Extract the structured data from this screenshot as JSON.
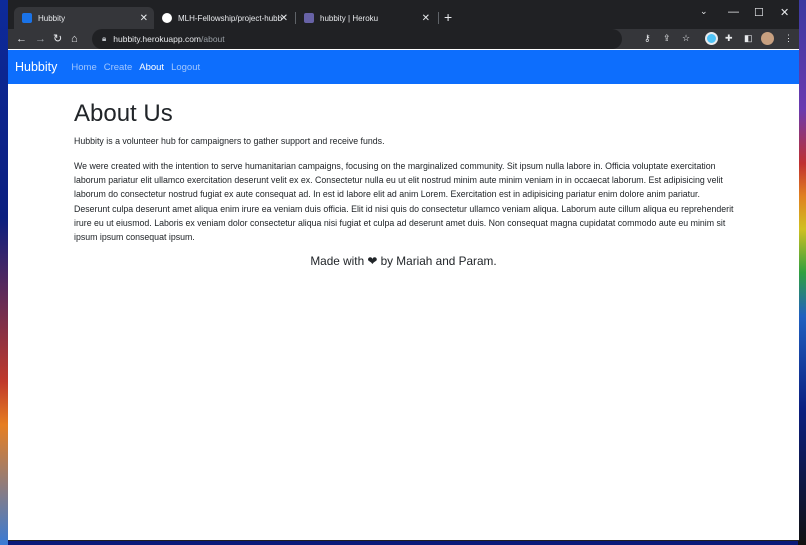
{
  "browser": {
    "tabs": [
      {
        "title": "Hubbity",
        "active": true,
        "favicon_color": "#1a73e8"
      },
      {
        "title": "MLH-Fellowship/project-hubbity",
        "active": false,
        "favicon_color": "#ffffff"
      },
      {
        "title": "hubbity | Heroku",
        "active": false,
        "favicon_color": "#6762a6"
      }
    ],
    "tab_close_glyph": "✕",
    "new_tab_glyph": "+",
    "url_host": "hubbity.herokuapp.com",
    "url_path": "/about"
  },
  "site": {
    "brand": "Hubbity",
    "nav": [
      {
        "label": "Home",
        "active": false
      },
      {
        "label": "Create",
        "active": false
      },
      {
        "label": "About",
        "active": true
      },
      {
        "label": "Logout",
        "active": false
      }
    ],
    "title": "About Us",
    "intro": "Hubbity is a volunteer hub for campaigners to gather support and receive funds.",
    "body": "We were created with the intention to serve humanitarian campaigns, focusing on the marginalized community. Sit ipsum nulla labore in. Officia voluptate exercitation laborum pariatur elit ullamco exercitation deserunt velit ex ex. Consectetur nulla eu ut elit nostrud minim aute minim veniam in in occaecat laborum. Est adipisicing velit laborum do consectetur nostrud fugiat ex aute consequat ad. In est id labore elit ad anim Lorem. Exercitation est in adipisicing pariatur enim dolore anim pariatur. Deserunt culpa deserunt amet aliqua enim irure ea veniam duis officia. Elit id nisi quis do consectetur ullamco veniam aliqua. Laborum aute cillum aliqua eu reprehenderit irure eu ut eiusmod. Laboris ex veniam dolor consectetur aliqua nisi fugiat et culpa ad deserunt amet duis. Non consequat magna cupidatat commodo aute eu minim sit ipsum ipsum consequat ipsum.",
    "footer": "Made with ❤ by Mariah and Param."
  },
  "colors": {
    "navbar": "#0d6efd",
    "browser_frame": "#202124",
    "toolbar": "#35363a"
  }
}
